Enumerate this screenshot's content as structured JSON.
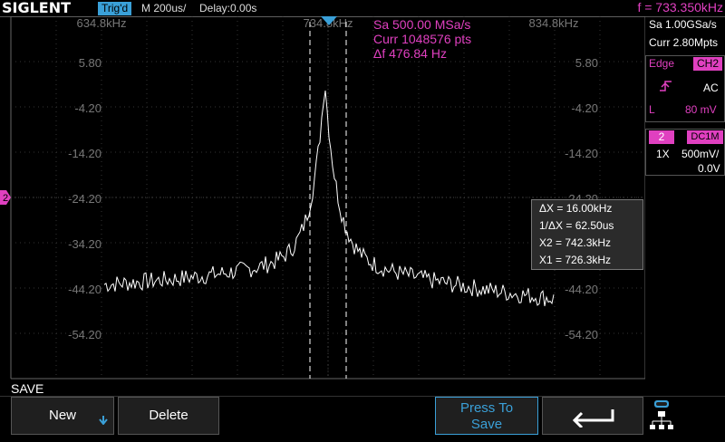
{
  "header": {
    "logo": "SIGLENT",
    "trigger_status": "Trig'd",
    "timebase": "M 200us/",
    "delay": "Delay:0.00s",
    "frequency": "f = 733.350kHz"
  },
  "plot": {
    "freq_labels": [
      "634.8kHz",
      "734.8kHz",
      "834.8kHz"
    ],
    "db_labels": [
      "5.80",
      "-4.20",
      "-14.20",
      "-24.20",
      "-34.20",
      "-44.20",
      "-54.20"
    ],
    "fft_info": {
      "sample_rate": "Sa 500.00 MSa/s",
      "curr": "Curr 1048576 pts",
      "delta_f": "Δf 476.84 Hz"
    },
    "ground_marker": "2"
  },
  "measurement": {
    "delta_x": "ΔX = 16.00kHz",
    "inv_delta_x": "1/ΔX = 62.50us",
    "x2": "X2 = 742.3kHz",
    "x1": "X1 = 726.3kHz"
  },
  "right_panel": {
    "sample_rate": "Sa 1.00GSa/s",
    "curr": "Curr 2.80Mpts",
    "trigger": {
      "type": "Edge",
      "source": "CH2",
      "coupling": "AC",
      "level_label": "L",
      "level": "80 mV"
    },
    "channel": {
      "number": "2",
      "coupling": "DC1M",
      "probe": "1X",
      "volts_div": "500mV/",
      "offset": "0.0V"
    }
  },
  "menu": {
    "title": "SAVE",
    "new_label": "New",
    "delete_label": "Delete",
    "press_to_save_line1": "Press To",
    "press_to_save_line2": "Save"
  },
  "colors": {
    "channel2": "#e040c0",
    "accent": "#3aa0d8",
    "trace": "#ffffff"
  },
  "trace": {
    "span_khz": [
      634.8,
      834.8
    ],
    "peak_khz": 733.35,
    "peak_db": -4.5,
    "floor_db": -44
  }
}
